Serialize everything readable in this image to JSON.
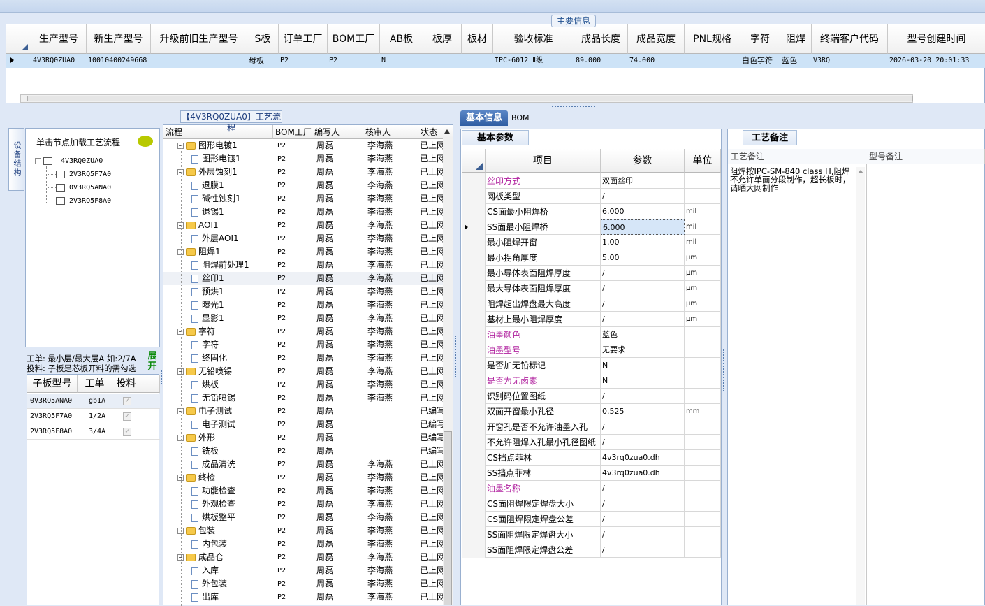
{
  "main": {
    "title": "主要信息",
    "columns": [
      "生产型号",
      "新生产型号",
      "升级前旧生产型号",
      "S板",
      "订单工厂",
      "BOM工厂",
      "AB板",
      "板厚",
      "板材",
      "验收标准",
      "成品长度",
      "成品宽度",
      "PNL规格",
      "字符",
      "阻焊",
      "终端客户代码",
      "型号创建时间"
    ],
    "row": [
      "4V3RQ0ZUA0",
      "10010400249668",
      "",
      "母板",
      "P2",
      "P2",
      "N",
      "",
      "",
      "IPC-6012 Ⅱ级",
      "89.000",
      "74.000",
      "",
      "白色字符",
      "蓝色",
      "V3RQ",
      "2026-03-20 20:01:33"
    ]
  },
  "left": {
    "vtab": "设备结构",
    "tip": "单击节点加载工艺流程",
    "tree_root": "4V3RQ0ZUA0",
    "tree_children": [
      "2V3RQ5F7A0",
      "0V3RQ5ANA0",
      "2V3RQ5F8A0"
    ],
    "info_line1": "工单: 最小层/最大层A 如:2/7A",
    "info_line2": "投料: 子板是芯板开料的需勾选",
    "expand_label": "展开",
    "sub_headers": [
      "子板型号",
      "工单",
      "投料"
    ],
    "sub_rows": [
      {
        "model": "0V3RQ5ANA0",
        "order": "gb1A",
        "feed": "✓"
      },
      {
        "model": "2V3RQ5F7A0",
        "order": "1/2A",
        "feed": "✓"
      },
      {
        "model": "2V3RQ5F8A0",
        "order": "3/4A",
        "feed": "✓"
      }
    ]
  },
  "flow": {
    "title": "【4V3RQ0ZUA0】工艺流程",
    "headers": [
      "流程",
      "BOM工厂",
      "编写人",
      "核审人",
      "状态"
    ],
    "rows": [
      {
        "name": "图形电镀1",
        "level": 0,
        "bom": "P2",
        "writer": "周磊",
        "reviewer": "李海燕",
        "status": "已上网"
      },
      {
        "name": "图形电镀1",
        "level": 1,
        "bom": "P2",
        "writer": "周磊",
        "reviewer": "李海燕",
        "status": "已上网"
      },
      {
        "name": "外层蚀刻1",
        "level": 0,
        "bom": "P2",
        "writer": "周磊",
        "reviewer": "李海燕",
        "status": "已上网"
      },
      {
        "name": "退膜1",
        "level": 1,
        "bom": "P2",
        "writer": "周磊",
        "reviewer": "李海燕",
        "status": "已上网"
      },
      {
        "name": "碱性蚀刻1",
        "level": 1,
        "bom": "P2",
        "writer": "周磊",
        "reviewer": "李海燕",
        "status": "已上网"
      },
      {
        "name": "退锡1",
        "level": 1,
        "bom": "P2",
        "writer": "周磊",
        "reviewer": "李海燕",
        "status": "已上网"
      },
      {
        "name": "AOI1",
        "level": 0,
        "bom": "P2",
        "writer": "周磊",
        "reviewer": "李海燕",
        "status": "已上网"
      },
      {
        "name": "外层AOI1",
        "level": 1,
        "bom": "P2",
        "writer": "周磊",
        "reviewer": "李海燕",
        "status": "已上网"
      },
      {
        "name": "阻焊1",
        "level": 0,
        "bom": "P2",
        "writer": "周磊",
        "reviewer": "李海燕",
        "status": "已上网"
      },
      {
        "name": "阻焊前处理1",
        "level": 1,
        "bom": "P2",
        "writer": "周磊",
        "reviewer": "李海燕",
        "status": "已上网"
      },
      {
        "name": "丝印1",
        "level": 1,
        "bom": "P2",
        "writer": "周磊",
        "reviewer": "李海燕",
        "status": "已上网"
      },
      {
        "name": "预烘1",
        "level": 1,
        "bom": "P2",
        "writer": "周磊",
        "reviewer": "李海燕",
        "status": "已上网"
      },
      {
        "name": "曝光1",
        "level": 1,
        "bom": "P2",
        "writer": "周磊",
        "reviewer": "李海燕",
        "status": "已上网"
      },
      {
        "name": "显影1",
        "level": 1,
        "bom": "P2",
        "writer": "周磊",
        "reviewer": "李海燕",
        "status": "已上网"
      },
      {
        "name": "字符",
        "level": 0,
        "bom": "P2",
        "writer": "周磊",
        "reviewer": "李海燕",
        "status": "已上网"
      },
      {
        "name": "字符",
        "level": 1,
        "bom": "P2",
        "writer": "周磊",
        "reviewer": "李海燕",
        "status": "已上网"
      },
      {
        "name": "终固化",
        "level": 1,
        "bom": "P2",
        "writer": "周磊",
        "reviewer": "李海燕",
        "status": "已上网"
      },
      {
        "name": "无铅喷锡",
        "level": 0,
        "bom": "P2",
        "writer": "周磊",
        "reviewer": "李海燕",
        "status": "已上网"
      },
      {
        "name": "烘板",
        "level": 1,
        "bom": "P2",
        "writer": "周磊",
        "reviewer": "李海燕",
        "status": "已上网"
      },
      {
        "name": "无铅喷锡",
        "level": 1,
        "bom": "P2",
        "writer": "周磊",
        "reviewer": "李海燕",
        "status": "已上网"
      },
      {
        "name": "电子测试",
        "level": 0,
        "bom": "P2",
        "writer": "周磊",
        "reviewer": "",
        "status": "已编写"
      },
      {
        "name": "电子测试",
        "level": 1,
        "bom": "P2",
        "writer": "周磊",
        "reviewer": "",
        "status": "已编写"
      },
      {
        "name": "外形",
        "level": 0,
        "bom": "P2",
        "writer": "周磊",
        "reviewer": "",
        "status": "已编写"
      },
      {
        "name": "铣板",
        "level": 1,
        "bom": "P2",
        "writer": "周磊",
        "reviewer": "",
        "status": "已编写"
      },
      {
        "name": "成品清洗",
        "level": 1,
        "bom": "P2",
        "writer": "周磊",
        "reviewer": "李海燕",
        "status": "已上网"
      },
      {
        "name": "终检",
        "level": 0,
        "bom": "P2",
        "writer": "周磊",
        "reviewer": "李海燕",
        "status": "已上网"
      },
      {
        "name": "功能检查",
        "level": 1,
        "bom": "P2",
        "writer": "周磊",
        "reviewer": "李海燕",
        "status": "已上网"
      },
      {
        "name": "外观检查",
        "level": 1,
        "bom": "P2",
        "writer": "周磊",
        "reviewer": "李海燕",
        "status": "已上网"
      },
      {
        "name": "烘板整平",
        "level": 1,
        "bom": "P2",
        "writer": "周磊",
        "reviewer": "李海燕",
        "status": "已上网"
      },
      {
        "name": "包装",
        "level": 0,
        "bom": "P2",
        "writer": "周磊",
        "reviewer": "李海燕",
        "status": "已上网"
      },
      {
        "name": "内包装",
        "level": 1,
        "bom": "P2",
        "writer": "周磊",
        "reviewer": "李海燕",
        "status": "已上网"
      },
      {
        "name": "成品仓",
        "level": 0,
        "bom": "P2",
        "writer": "周磊",
        "reviewer": "李海燕",
        "status": "已上网"
      },
      {
        "name": "入库",
        "level": 1,
        "bom": "P2",
        "writer": "周磊",
        "reviewer": "李海燕",
        "status": "已上网"
      },
      {
        "name": "外包装",
        "level": 1,
        "bom": "P2",
        "writer": "周磊",
        "reviewer": "李海燕",
        "status": "已上网"
      },
      {
        "name": "出库",
        "level": 1,
        "bom": "P2",
        "writer": "周磊",
        "reviewer": "李海燕",
        "status": "已上网"
      }
    ]
  },
  "tabs": {
    "basic": "基本信息",
    "bom": "BOM"
  },
  "params": {
    "title": "基本参数",
    "headers": [
      "项目",
      "参数",
      "单位"
    ],
    "rows": [
      {
        "item": "丝印方式",
        "value": "双面丝印",
        "unit": "",
        "hl": true
      },
      {
        "item": "网板类型",
        "value": "/",
        "unit": "",
        "hl": false
      },
      {
        "item": "CS面最小阻焊桥",
        "value": "6.000",
        "unit": "mil",
        "hl": false
      },
      {
        "item": "SS面最小阻焊桥",
        "value": "6.000",
        "unit": "mil",
        "hl": false
      },
      {
        "item": "最小阻焊开窗",
        "value": "1.00",
        "unit": "mil",
        "hl": false
      },
      {
        "item": "最小拐角厚度",
        "value": "5.00",
        "unit": "μm",
        "hl": false
      },
      {
        "item": "最小导体表面阻焊厚度",
        "value": "/",
        "unit": "μm",
        "hl": false
      },
      {
        "item": "最大导体表面阻焊厚度",
        "value": "/",
        "unit": "μm",
        "hl": false
      },
      {
        "item": "阻焊超出焊盘最大高度",
        "value": "/",
        "unit": "μm",
        "hl": false
      },
      {
        "item": "基材上最小阻焊厚度",
        "value": "/",
        "unit": "μm",
        "hl": false
      },
      {
        "item": "油墨颜色",
        "value": "蓝色",
        "unit": "",
        "hl": true
      },
      {
        "item": "油墨型号",
        "value": "无要求",
        "unit": "",
        "hl": true
      },
      {
        "item": "是否加无铅标记",
        "value": "N",
        "unit": "",
        "hl": false
      },
      {
        "item": "是否为无卤素",
        "value": "N",
        "unit": "",
        "hl": true
      },
      {
        "item": "识别码位置图纸",
        "value": "/",
        "unit": "",
        "hl": false
      },
      {
        "item": "双面开窗最小孔径",
        "value": "0.525",
        "unit": "mm",
        "hl": false
      },
      {
        "item": "开窗孔是否不允许油墨入孔",
        "value": "/",
        "unit": "",
        "hl": false
      },
      {
        "item": "不允许阻焊入孔最小孔径图纸",
        "value": "/",
        "unit": "",
        "hl": false
      },
      {
        "item": "CS挡点菲林",
        "value": "4v3rq0zua0.dh",
        "unit": "",
        "hl": false
      },
      {
        "item": "SS挡点菲林",
        "value": "4v3rq0zua0.dh",
        "unit": "",
        "hl": false
      },
      {
        "item": "油墨名称",
        "value": "/",
        "unit": "",
        "hl": true
      },
      {
        "item": "CS面阻焊限定焊盘大小",
        "value": "/",
        "unit": "",
        "hl": false
      },
      {
        "item": "CS面阻焊限定焊盘公差",
        "value": "/",
        "unit": "",
        "hl": false
      },
      {
        "item": "SS面阻焊限定焊盘大小",
        "value": "/",
        "unit": "",
        "hl": false
      },
      {
        "item": "SS面阻焊限定焊盘公差",
        "value": "/",
        "unit": "",
        "hl": false
      }
    ]
  },
  "notes": {
    "title": "工艺备注",
    "col1": "工艺备注",
    "col2": "型号备注",
    "text": "阻焊按IPC-SM-840 class H,阻焊不允许单面分段制作，超长板时，请晒大网制作"
  },
  "colors": {
    "highlight_text": "#b0209e",
    "selected_row": "#cde3f7",
    "accent": "#2f5da3"
  }
}
